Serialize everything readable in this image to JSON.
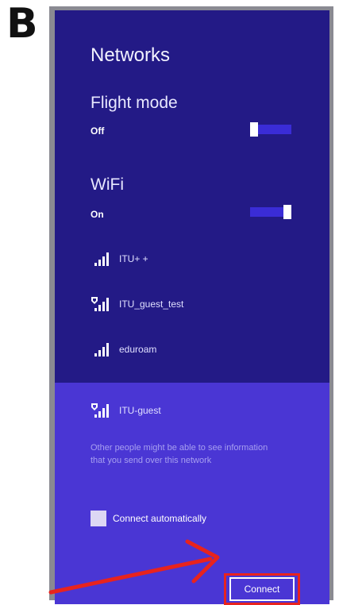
{
  "figure_label": "B",
  "panel": {
    "title": "Networks",
    "flight_mode": {
      "label": "Flight mode",
      "state": "Off"
    },
    "wifi": {
      "label": "WiFi",
      "state": "On"
    },
    "networks": [
      {
        "name": "ITU+ +",
        "secured": false
      },
      {
        "name": "ITU_guest_test",
        "secured": true
      },
      {
        "name": "eduroam",
        "secured": false
      },
      {
        "name": "ITU-guest",
        "secured": true,
        "expanded": true
      }
    ],
    "selected_network": {
      "warning": "Other people might be able to see information that you send over this network",
      "auto_connect_label": "Connect automatically",
      "connect_button": "Connect"
    }
  },
  "colors": {
    "panel_bg": "#231a86",
    "selected_bg": "#4a36d4",
    "toggle_track": "#3a2cd6",
    "highlight": "#e8231e"
  }
}
